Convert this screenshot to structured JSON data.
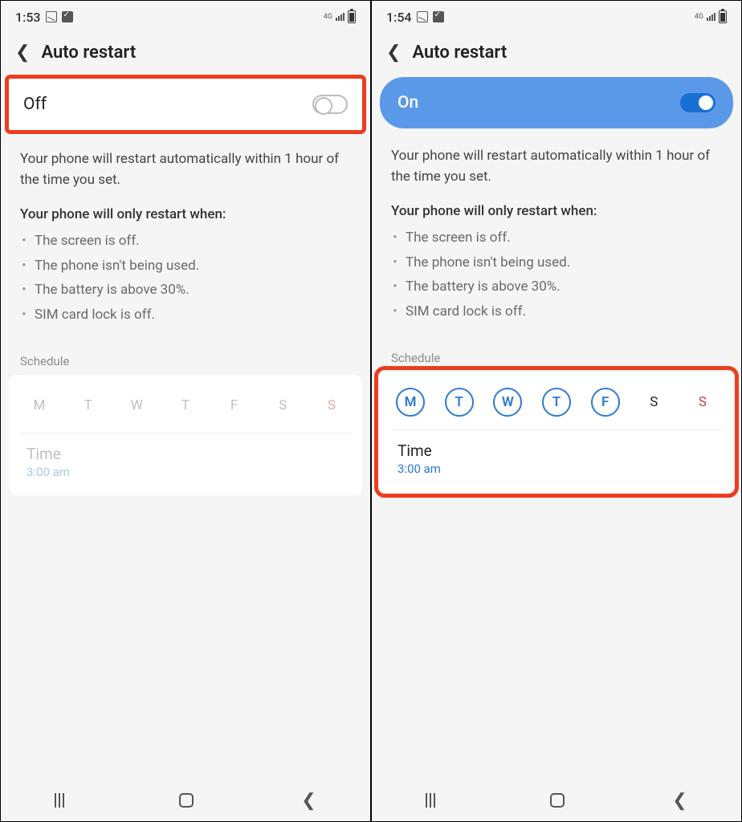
{
  "left": {
    "status": {
      "time": "1:53",
      "network": "4G"
    },
    "title": "Auto restart",
    "toggle": {
      "label": "Off",
      "state": "off"
    },
    "description": "Your phone will restart automatically within 1 hour of the time you set.",
    "conditions_title": "Your phone will only restart when:",
    "conditions": [
      "The screen is off.",
      "The phone isn't being used.",
      "The battery is above 30%.",
      "SIM card lock is off."
    ],
    "schedule_label": "Schedule",
    "days": [
      "M",
      "T",
      "W",
      "T",
      "F",
      "S",
      "S"
    ],
    "time_label": "Time",
    "time_value": "3:00 am"
  },
  "right": {
    "status": {
      "time": "1:54",
      "network": "4G"
    },
    "title": "Auto restart",
    "toggle": {
      "label": "On",
      "state": "on"
    },
    "description": "Your phone will restart automatically within 1 hour of the time you set.",
    "conditions_title": "Your phone will only restart when:",
    "conditions": [
      "The screen is off.",
      "The phone isn't being used.",
      "The battery is above 30%.",
      "SIM card lock is off."
    ],
    "schedule_label": "Schedule",
    "days": [
      {
        "l": "M",
        "sel": true
      },
      {
        "l": "T",
        "sel": true
      },
      {
        "l": "W",
        "sel": true
      },
      {
        "l": "T",
        "sel": true
      },
      {
        "l": "F",
        "sel": true
      },
      {
        "l": "S",
        "sel": false
      },
      {
        "l": "S",
        "sel": false,
        "sunday": true
      }
    ],
    "time_label": "Time",
    "time_value": "3:00 am"
  }
}
